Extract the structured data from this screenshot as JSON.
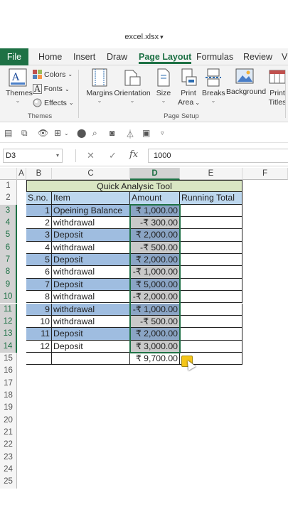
{
  "window": {
    "filename": "excel.xlsx"
  },
  "tabs": [
    "File",
    "Home",
    "Insert",
    "Draw",
    "Page Layout",
    "Formulas",
    "Review"
  ],
  "active_tab": "Page Layout",
  "ribbon": {
    "themes_group": {
      "themes": "Themes",
      "colors": "Colors",
      "fonts": "Fonts",
      "effects": "Effects",
      "label": "Themes"
    },
    "page_setup_group": {
      "margins": "Margins",
      "orientation": "Orientation",
      "size": "Size",
      "print_area_1": "Print",
      "print_area_2": "Area",
      "breaks": "Breaks",
      "background": "Background",
      "print_titles_1": "Print",
      "print_titles_2": "Titles",
      "label": "Page Setup"
    }
  },
  "formula_bar": {
    "name_box": "D3",
    "value": "1000"
  },
  "columns": [
    "A",
    "B",
    "C",
    "D",
    "E",
    "F"
  ],
  "rows": [
    "1",
    "2",
    "3",
    "4",
    "5",
    "6",
    "7",
    "8",
    "9",
    "10",
    "11",
    "12",
    "13",
    "14",
    "15",
    "16",
    "17",
    "18",
    "19",
    "20",
    "21",
    "22",
    "23",
    "24",
    "25"
  ],
  "sheet": {
    "title": "Quick Analysic Tool",
    "headers": {
      "sno": "S.no.",
      "item": "Item",
      "amount": "Amount",
      "running_total": "Running Total"
    },
    "records": [
      {
        "sno": "1",
        "item": "Opeining Balance",
        "amount": "₹ 1,000.00"
      },
      {
        "sno": "2",
        "item": "withdrawal",
        "amount": "-₹ 300.00"
      },
      {
        "sno": "3",
        "item": "Deposit",
        "amount": "₹ 2,000.00"
      },
      {
        "sno": "4",
        "item": "withdrawal",
        "amount": "-₹ 500.00"
      },
      {
        "sno": "5",
        "item": "Deposit",
        "amount": "₹ 2,000.00"
      },
      {
        "sno": "6",
        "item": "withdrawal",
        "amount": "-₹ 1,000.00"
      },
      {
        "sno": "7",
        "item": "Deposit",
        "amount": "₹ 5,000.00"
      },
      {
        "sno": "8",
        "item": "withdrawal",
        "amount": "-₹ 2,000.00"
      },
      {
        "sno": "9",
        "item": "withdrawal",
        "amount": "-₹ 1,000.00"
      },
      {
        "sno": "10",
        "item": "withdrawal",
        "amount": "-₹ 500.00"
      },
      {
        "sno": "11",
        "item": "Deposit",
        "amount": "₹ 2,000.00"
      },
      {
        "sno": "12",
        "item": "Deposit",
        "amount": "₹ 3,000.00"
      }
    ],
    "total": "₹ 9,700.00"
  },
  "colors": {
    "accent": "#1e7145",
    "title_fill": "#d9e6c3",
    "header_fill": "#bdd7ee",
    "row_fill": "#9fbde0"
  }
}
